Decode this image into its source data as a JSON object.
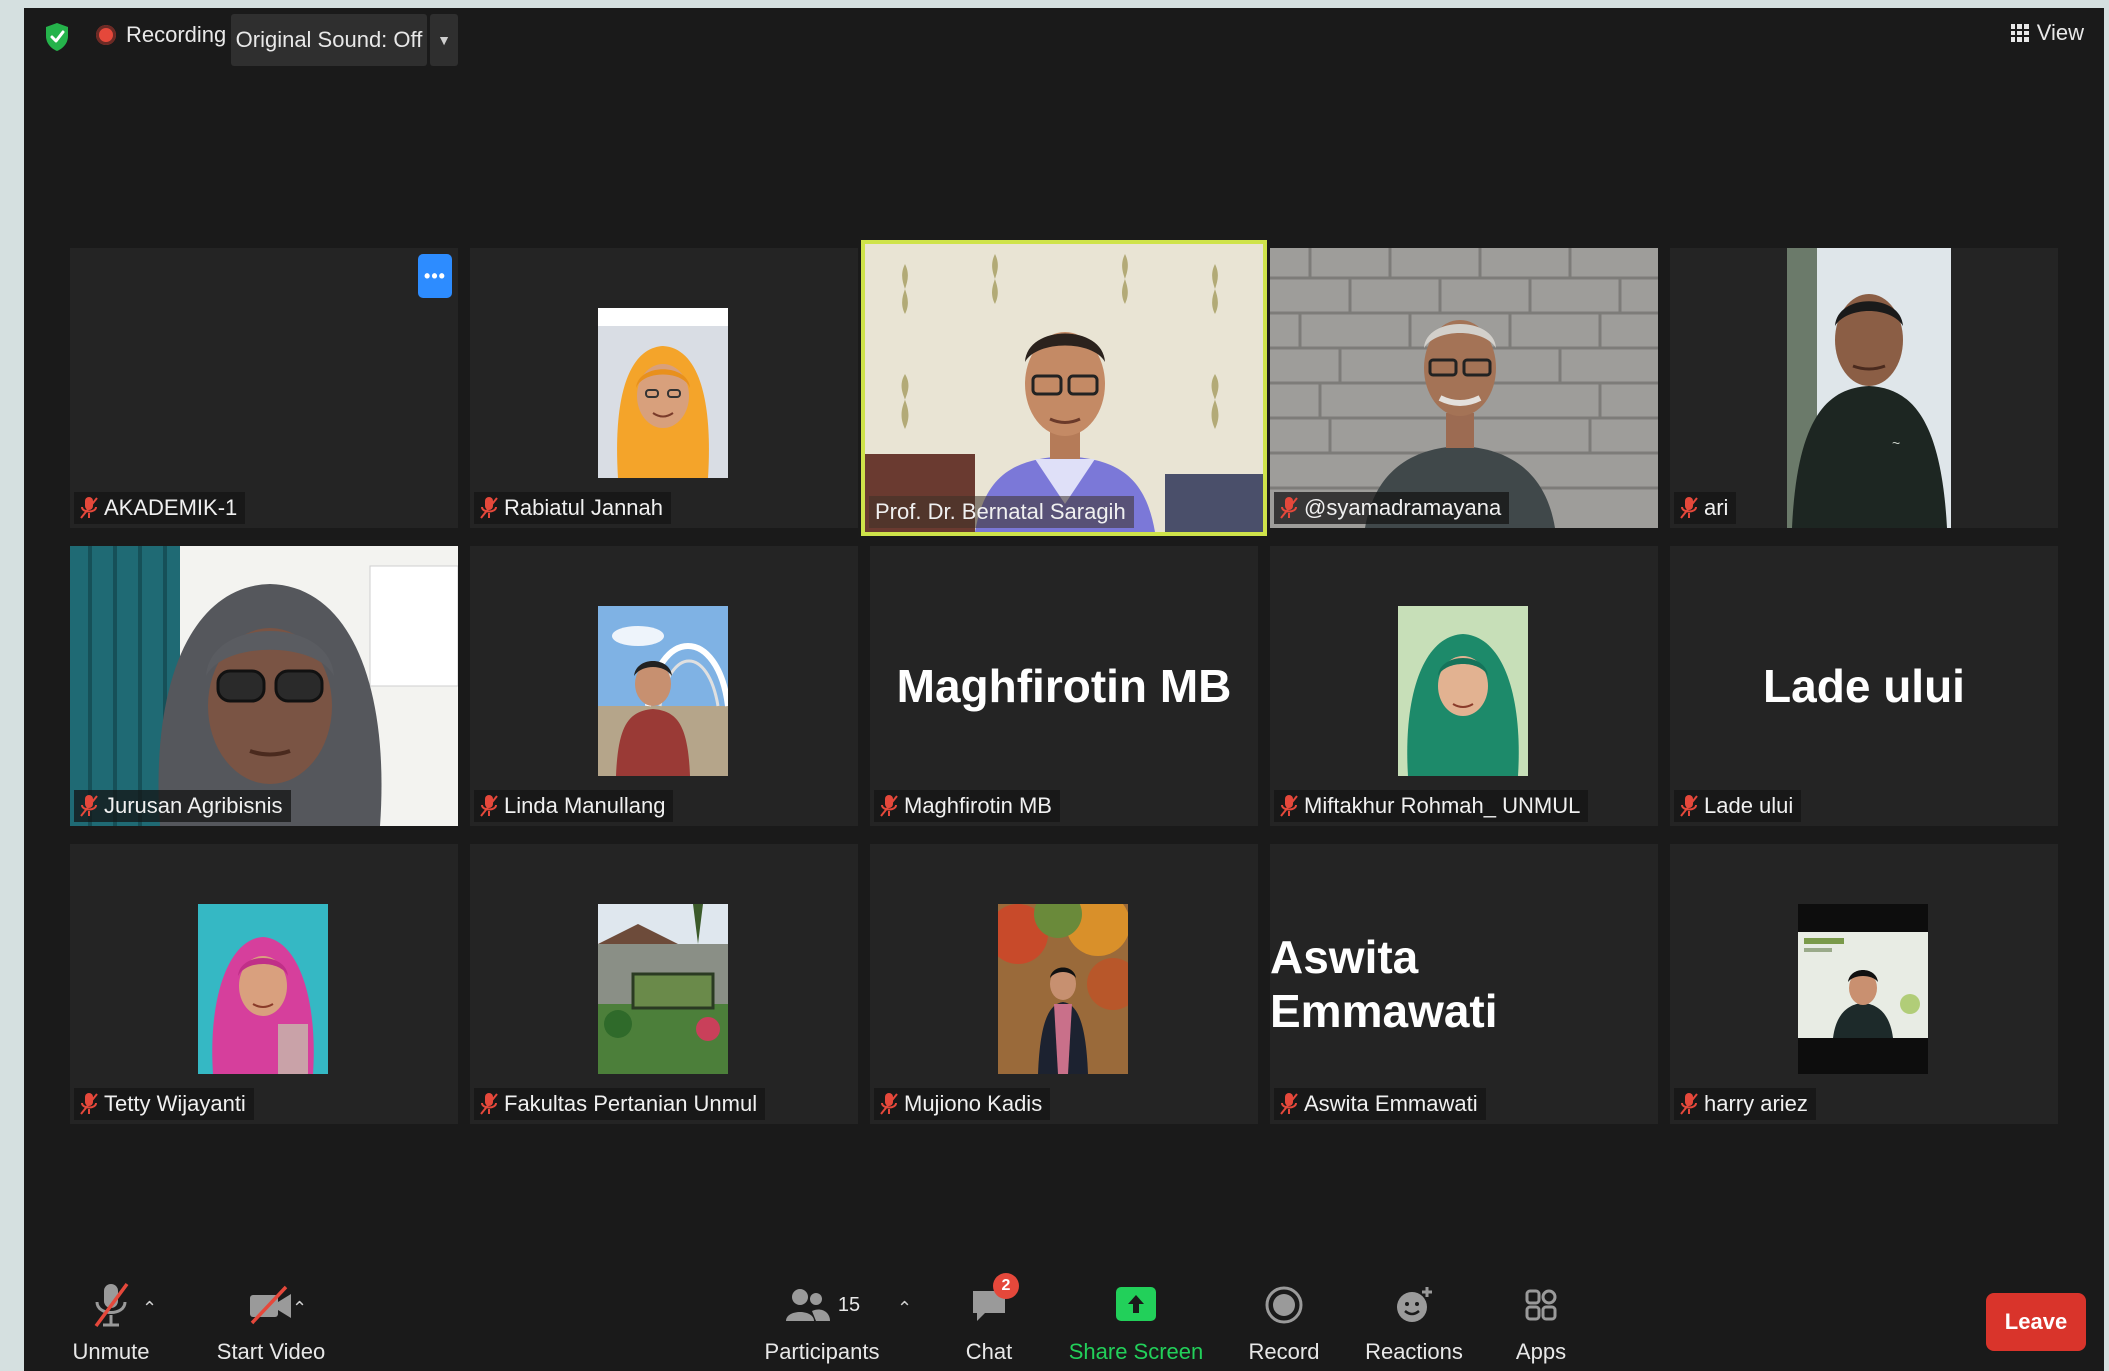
{
  "topbar": {
    "recording_label": "Recording",
    "original_sound_label": "Original Sound: Off",
    "view_label": "View"
  },
  "participants": [
    {
      "name": "AKADEMIK-1",
      "display": "none",
      "mic": "muted"
    },
    {
      "name": "Rabiatul Jannah",
      "display": "photo",
      "mic": "muted"
    },
    {
      "name": "Prof. Dr. Bernatal Saragih",
      "display": "video",
      "mic": "on",
      "active_speaker": true
    },
    {
      "name": "@syamadramayana",
      "display": "video",
      "mic": "muted"
    },
    {
      "name": "ari",
      "display": "video",
      "mic": "muted"
    },
    {
      "name": "Jurusan Agribisnis",
      "display": "video",
      "mic": "muted"
    },
    {
      "name": "Linda Manullang",
      "display": "photo",
      "mic": "muted"
    },
    {
      "name": "Maghfirotin MB",
      "display": "name",
      "big_name": "Maghfirotin MB",
      "mic": "muted"
    },
    {
      "name": "Miftakhur Rohmah_ UNMUL",
      "display": "photo",
      "mic": "muted"
    },
    {
      "name": "Lade ului",
      "display": "name",
      "big_name": "Lade ului",
      "mic": "muted"
    },
    {
      "name": "Tetty Wijayanti",
      "display": "photo",
      "mic": "muted"
    },
    {
      "name": "Fakultas Pertanian Unmul",
      "display": "photo",
      "mic": "muted"
    },
    {
      "name": "Mujiono Kadis",
      "display": "photo",
      "mic": "muted"
    },
    {
      "name": "Aswita Emmawati",
      "display": "name",
      "big_name": "Aswita Emmawati",
      "mic": "muted"
    },
    {
      "name": "harry ariez",
      "display": "photo",
      "mic": "muted"
    }
  ],
  "toolbar": {
    "unmute": "Unmute",
    "start_video": "Start Video",
    "participants": "Participants",
    "participants_count": "15",
    "chat": "Chat",
    "chat_badge": "2",
    "share_screen": "Share Screen",
    "record": "Record",
    "reactions": "Reactions",
    "apps": "Apps",
    "leave": "Leave"
  },
  "colors": {
    "background": "#1a1a1a",
    "tile": "#242424",
    "active_speaker_border": "#cfe34a",
    "muted_mic": "#e5483b",
    "share_screen": "#22d05a",
    "leave": "#d9342b",
    "accent_blue": "#2d8cff"
  },
  "icons": [
    "shield-icon",
    "record-dot-icon",
    "caret-down-icon",
    "grid-view-icon",
    "mic-muted-icon",
    "more-icon",
    "video-off-icon",
    "participants-icon",
    "chat-icon",
    "share-screen-icon",
    "record-icon",
    "reactions-icon",
    "apps-icon"
  ]
}
